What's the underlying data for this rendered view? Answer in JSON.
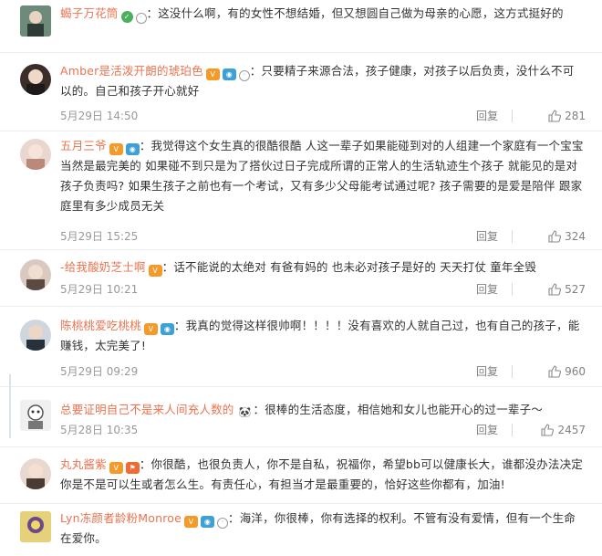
{
  "comments": [
    {
      "username": "蝎子万花筒",
      "badges": [
        "green",
        "ring"
      ],
      "content": "这没什么啊，有的女性不想结婚，但又想圆自己做为母亲的心愿，这方式挺好的"
    },
    {
      "username": "Amber是活泼开朗的琥珀色",
      "badges": [
        "vip",
        "cam",
        "ring"
      ],
      "content": "只要精子来源合法，孩子健康，对孩子以后负责，没什么不可以的。自己和孩子开心就好",
      "time": "5月29日 14:50",
      "reply_label": "回复",
      "likes": "281"
    },
    {
      "username": "五月三爷",
      "badges": [
        "vip",
        "cam"
      ],
      "content": "我觉得这个女生真的很酷很酷 人这一辈子如果能碰到对的人组建一个家庭有一个宝宝当然是最完美的 如果碰不到只是为了搭伙过日子完成所谓的正常人的生活轨迹生个孩子 就能见的是对孩子负责吗? 如果生孩子之前也有一个考试，又有多少父母能考试通过呢? 孩子需要的是爱是陪伴 跟家庭里有多少成员无关",
      "time": "5月29日 15:25",
      "reply_label": "回复",
      "likes": "324"
    },
    {
      "username": "-给我酸奶芝士啊",
      "badges": [
        "vip"
      ],
      "content": "话不能说的太绝对 有爸有妈的 也未必对孩子是好的 天天打仗 童年全毁",
      "time": "5月29日 10:21",
      "reply_label": "回复",
      "likes": "527"
    },
    {
      "username": "陈桃桃爱吃桃桃",
      "badges": [
        "vip",
        "cam"
      ],
      "content": "我真的觉得这样很帅啊！！！！没有喜欢的人就自己过，也有自己的孩子，能赚钱，太完美了!",
      "time": "5月29日 09:29",
      "reply_label": "回复",
      "likes": "960"
    },
    {
      "username": "总要证明自己不是来人间充人数的",
      "badges": [
        "panda"
      ],
      "content": "很棒的生活态度，相信她和女儿也能开心的过一辈子～",
      "time": "5月28日 10:35",
      "reply_label": "回复",
      "likes": "2457"
    },
    {
      "username": "丸丸酱紫",
      "badges": [
        "vip",
        "flag"
      ],
      "content": "你很酷，也很负责人，你不是自私，祝福你，希望bb可以健康长大，谁都没办法决定你是不是可以生或者怎么生。有责任心，有担当才是最重要的，恰好这些你都有，加油!"
    },
    {
      "username": "Lyn冻颜者龄粉Monroe",
      "badges": [
        "vip",
        "cam",
        "ring"
      ],
      "content": "海洋，你很棒，你有选择的权利。不管有没有爱情，但有一个生命在爱你。"
    }
  ]
}
